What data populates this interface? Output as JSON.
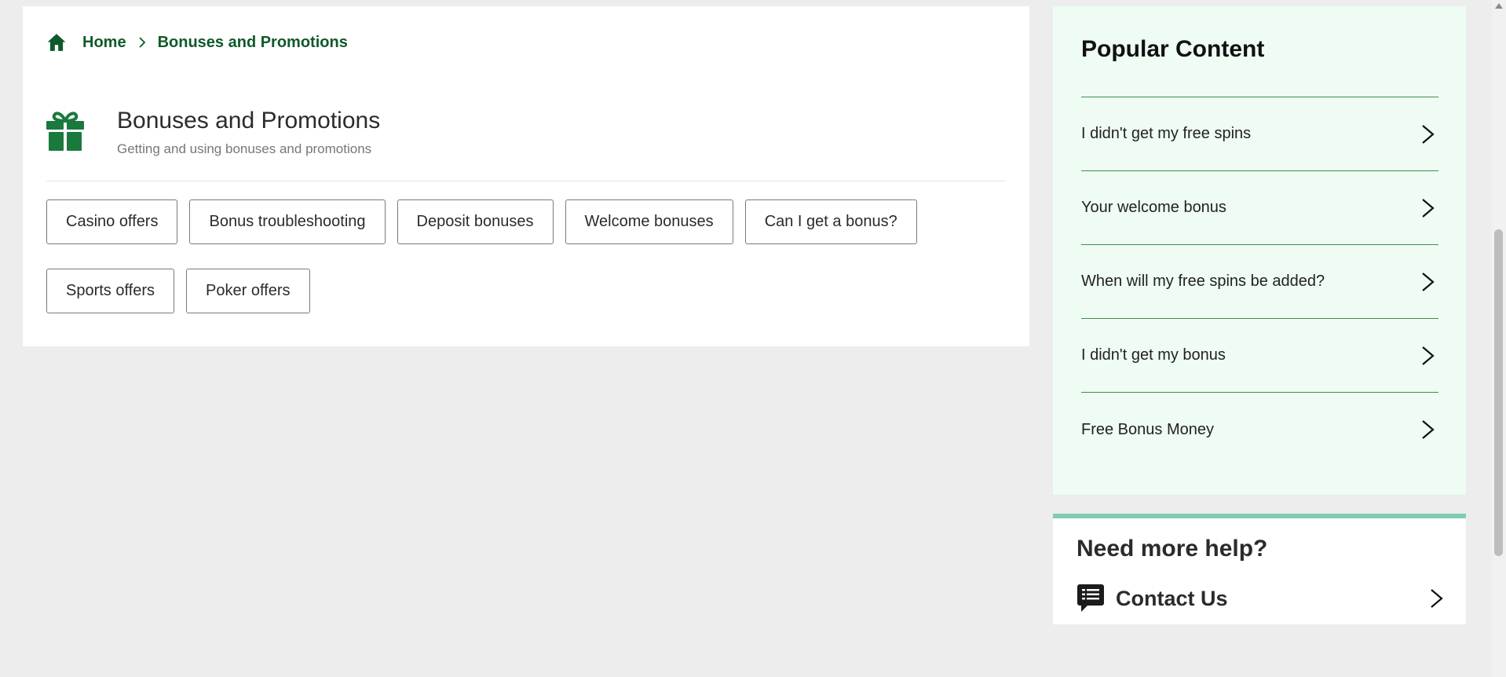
{
  "breadcrumb": {
    "home_label": "Home",
    "current_label": "Bonuses and Promotions"
  },
  "header": {
    "title": "Bonuses and Promotions",
    "subtitle": "Getting and using bonuses and promotions",
    "icon": "gift-icon"
  },
  "chips": {
    "row1": [
      "Casino offers",
      "Bonus troubleshooting",
      "Deposit bonuses",
      "Welcome bonuses",
      "Can I get a bonus?"
    ],
    "row2": [
      "Sports offers",
      "Poker offers"
    ]
  },
  "popular": {
    "title": "Popular Content",
    "items": [
      "I didn't get my free spins",
      "Your welcome bonus",
      "When will my free spins be added?",
      "I didn't get my bonus",
      "Free Bonus Money"
    ]
  },
  "help": {
    "title": "Need more help?",
    "contact_label": "Contact Us",
    "icon": "chat-icon"
  },
  "colors": {
    "brand_green": "#0f5a2a",
    "gift_green": "#1a7a3e",
    "popular_bg": "#eefcf4",
    "divider_green": "#3f8f4a",
    "help_accent": "#80cdb0",
    "page_bg": "#ededed"
  }
}
